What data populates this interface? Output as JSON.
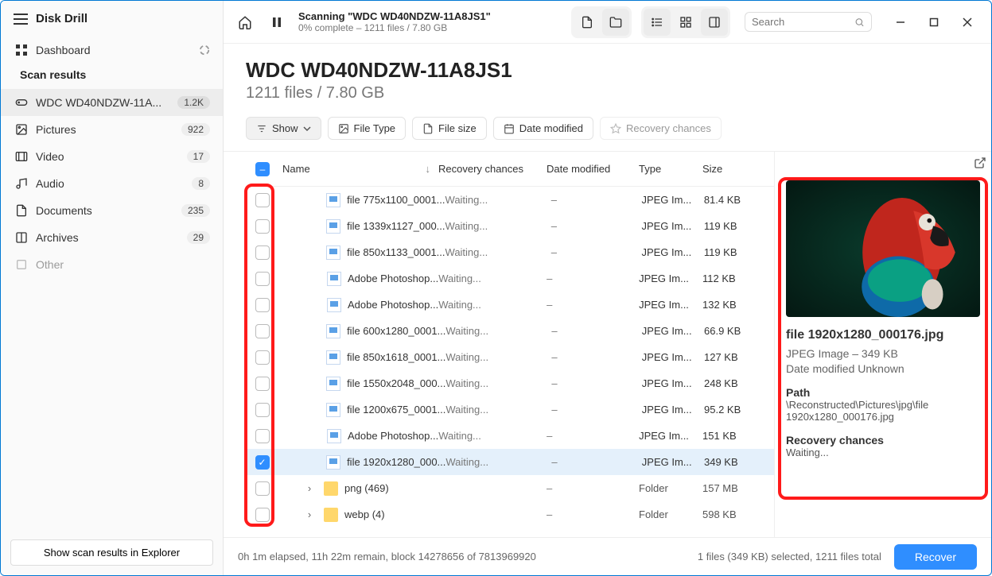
{
  "app": {
    "title": "Disk Drill"
  },
  "sidebar": {
    "dashboard": "Dashboard",
    "section": "Scan results",
    "items": [
      {
        "label": "WDC WD40NDZW-11A...",
        "count": "1.2K",
        "active": true,
        "icon": "drive"
      },
      {
        "label": "Pictures",
        "count": "922",
        "icon": "image"
      },
      {
        "label": "Video",
        "count": "17",
        "icon": "video"
      },
      {
        "label": "Audio",
        "count": "8",
        "icon": "audio"
      },
      {
        "label": "Documents",
        "count": "235",
        "icon": "doc"
      },
      {
        "label": "Archives",
        "count": "29",
        "icon": "archive"
      },
      {
        "label": "Other",
        "count": "",
        "icon": "other",
        "muted": true
      }
    ],
    "footer_btn": "Show scan results in Explorer"
  },
  "titlebar": {
    "scan_title": "Scanning \"WDC WD40NDZW-11A8JS1\"",
    "scan_sub": "0% complete – 1211 files / 7.80 GB",
    "search_placeholder": "Search"
  },
  "page": {
    "title": "WDC WD40NDZW-11A8JS1",
    "subtitle": "1211 files / 7.80 GB"
  },
  "filters": {
    "show": "Show",
    "ftype": "File Type",
    "fsize": "File size",
    "fdate": "Date modified",
    "frec": "Recovery chances"
  },
  "columns": {
    "name": "Name",
    "rec": "Recovery chances",
    "date": "Date modified",
    "type": "Type",
    "size": "Size"
  },
  "rows": [
    {
      "name": "file 775x1100_0001...",
      "rec": "Waiting...",
      "date": "–",
      "type": "JPEG Im...",
      "size": "81.4 KB"
    },
    {
      "name": "file 1339x1127_000...",
      "rec": "Waiting...",
      "date": "–",
      "type": "JPEG Im...",
      "size": "119 KB"
    },
    {
      "name": "file 850x1133_0001...",
      "rec": "Waiting...",
      "date": "–",
      "type": "JPEG Im...",
      "size": "119 KB"
    },
    {
      "name": "Adobe Photoshop...",
      "rec": "Waiting...",
      "date": "–",
      "type": "JPEG Im...",
      "size": "112 KB"
    },
    {
      "name": "Adobe Photoshop...",
      "rec": "Waiting...",
      "date": "–",
      "type": "JPEG Im...",
      "size": "132 KB"
    },
    {
      "name": "file 600x1280_0001...",
      "rec": "Waiting...",
      "date": "–",
      "type": "JPEG Im...",
      "size": "66.9 KB"
    },
    {
      "name": "file 850x1618_0001...",
      "rec": "Waiting...",
      "date": "–",
      "type": "JPEG Im...",
      "size": "127 KB"
    },
    {
      "name": "file 1550x2048_000...",
      "rec": "Waiting...",
      "date": "–",
      "type": "JPEG Im...",
      "size": "248 KB"
    },
    {
      "name": "file 1200x675_0001...",
      "rec": "Waiting...",
      "date": "–",
      "type": "JPEG Im...",
      "size": "95.2 KB"
    },
    {
      "name": "Adobe Photoshop...",
      "rec": "Waiting...",
      "date": "–",
      "type": "JPEG Im...",
      "size": "151 KB"
    },
    {
      "name": "file 1920x1280_000...",
      "rec": "Waiting...",
      "date": "–",
      "type": "JPEG Im...",
      "size": "349 KB",
      "selected": true
    },
    {
      "name": "png (469)",
      "rec": "",
      "date": "–",
      "type": "Folder",
      "size": "157 MB",
      "folder": true
    },
    {
      "name": "webp (4)",
      "rec": "",
      "date": "–",
      "type": "Folder",
      "size": "598 KB",
      "folder": true
    }
  ],
  "preview": {
    "filename": "file 1920x1280_000176.jpg",
    "meta": "JPEG Image – 349 KB",
    "modified": "Date modified Unknown",
    "path_label": "Path",
    "path": "\\Reconstructed\\Pictures\\jpg\\file 1920x1280_000176.jpg",
    "rec_label": "Recovery chances",
    "rec_value": "Waiting..."
  },
  "footer": {
    "status": "0h 1m elapsed, 11h 22m remain, block 14278656 of 7813969920",
    "selection": "1 files (349 KB) selected, 1211 files total",
    "recover": "Recover"
  }
}
